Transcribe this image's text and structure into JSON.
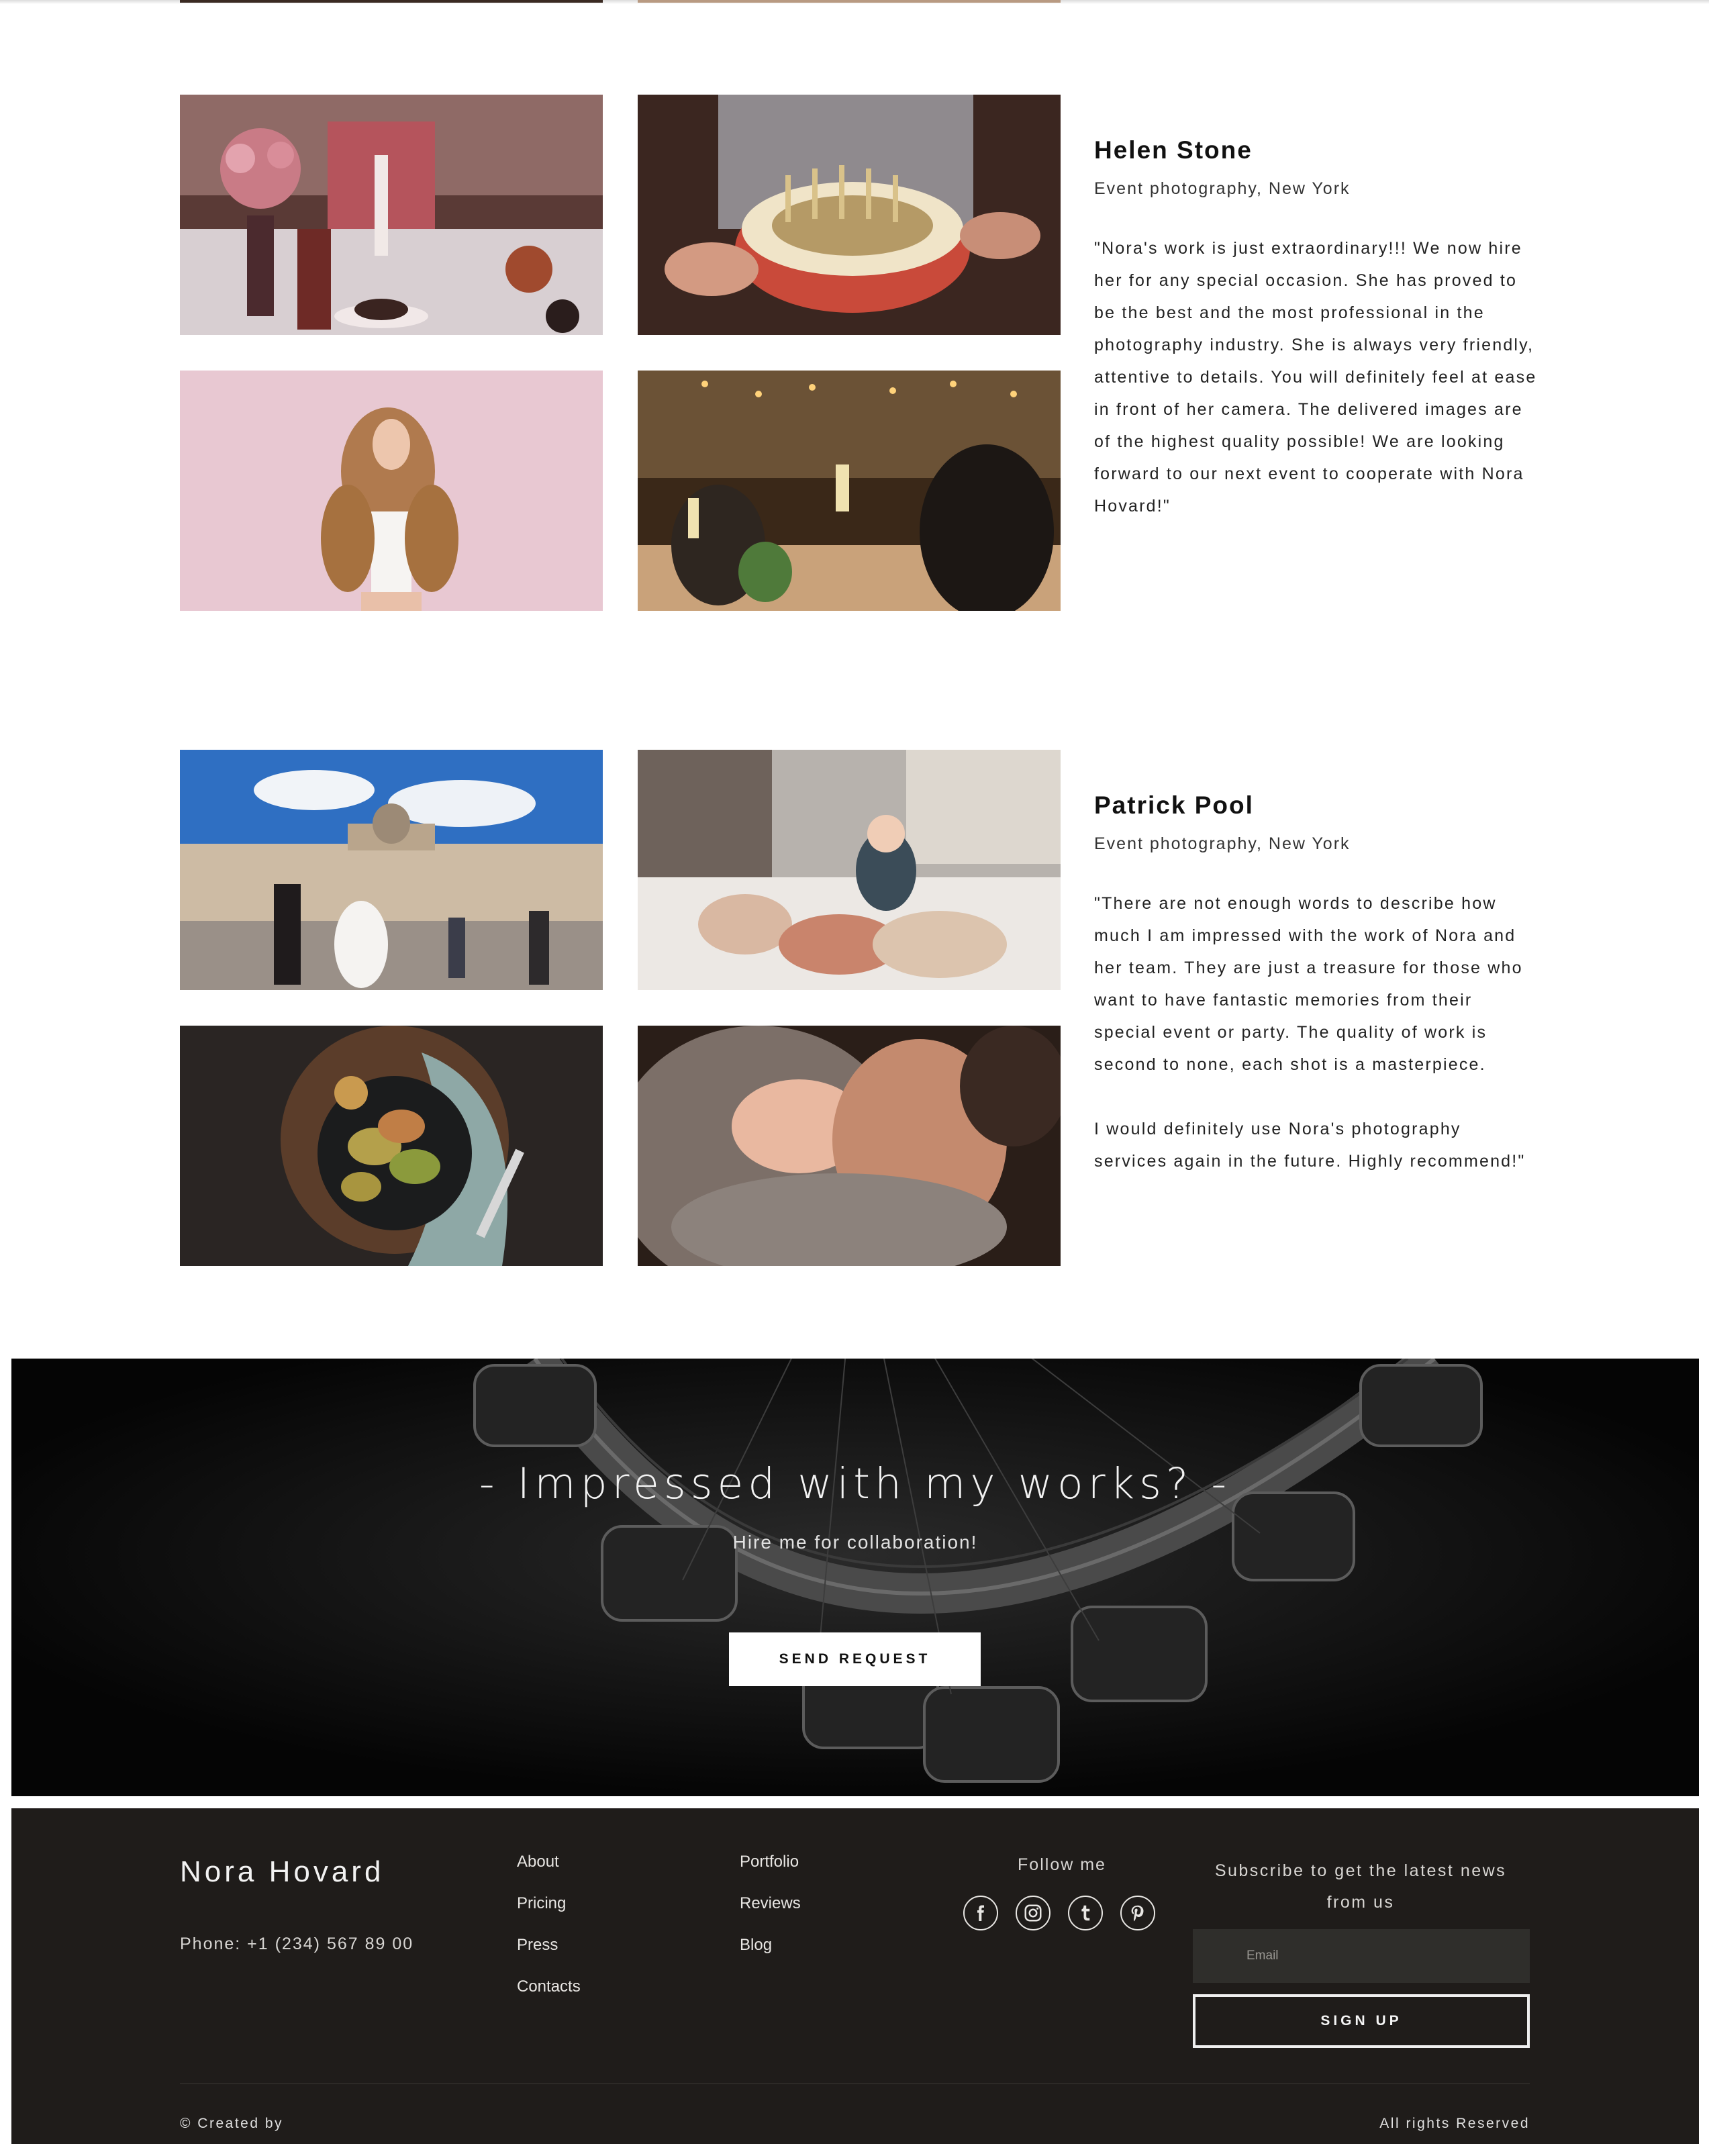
{
  "reviews": [
    {
      "name": "Helen Stone",
      "role": "Event photography, New York",
      "quote": "\"Nora's work is just extraordinary!!! We now hire her for any special occasion. She has proved to be the best and the most professional in the photography industry. She is always very friendly, attentive to details. You will definitely feel at ease in front of her camera. The delivered images are of the highest quality possible! We are looking forward to our next event to cooperate with Nora Hovard!\""
    },
    {
      "name": "Patrick Pool",
      "role": "Event photography, New York",
      "quote": "\"There are not enough words to describe how much I am impressed with the work of Nora and her team. They are just a treasure for those who want to have fantastic memories from their special event or party. The quality of work is second to none, each shot is a masterpiece.\n\nI would definitely use Nora's photography services again in the future. Highly recommend!\""
    }
  ],
  "cta": {
    "title": "- Impressed with my works? -",
    "subtitle": "Hire me for collaboration!",
    "button_label": "SEND REQUEST"
  },
  "footer": {
    "brand": "Nora Hovard",
    "phone": "Phone: +1 (234) 567 89 00",
    "links_col1": [
      "About",
      "Pricing",
      "Press",
      "Contacts"
    ],
    "links_col2": [
      "Portfolio",
      "Reviews",
      "Blog"
    ],
    "follow_title": "Follow me",
    "socials": [
      "facebook-icon",
      "instagram-icon",
      "tumblr-icon",
      "pinterest-icon"
    ],
    "subscribe_title": "Subscribe to get the latest news from us",
    "email_placeholder": "Email",
    "signup_label": "SIGN UP",
    "created_by": "© Created by",
    "rights": "All rights Reserved"
  },
  "colors": {
    "footer_bg": "#1f1c1a",
    "cta_bg": "#050505",
    "input_bg": "#2f2e2b"
  }
}
